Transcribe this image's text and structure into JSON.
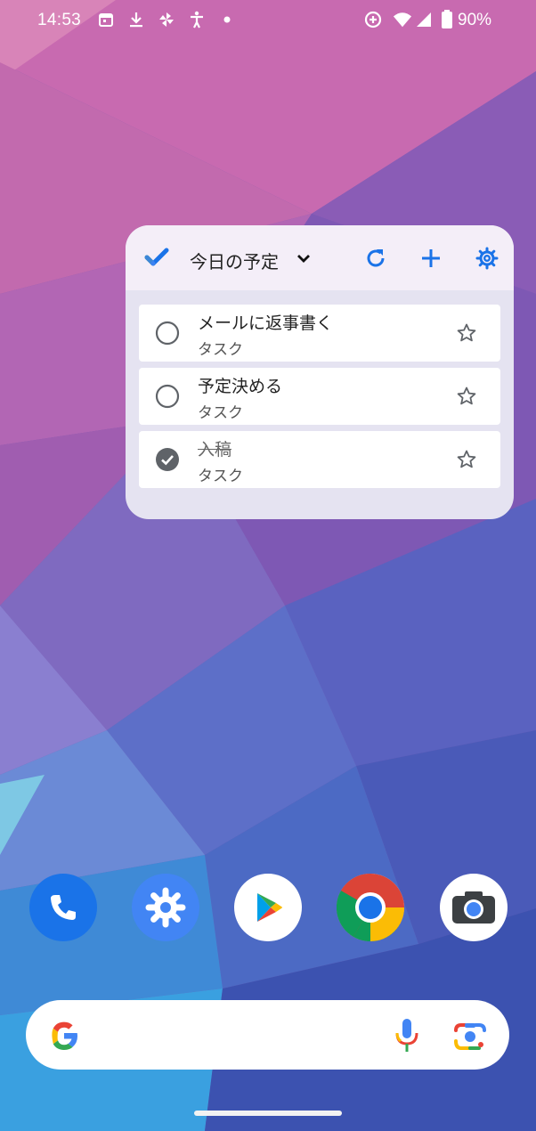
{
  "status_bar": {
    "time": "14:53",
    "battery": "90%",
    "left_icons": [
      "calendar-icon",
      "download-icon",
      "pinwheel-icon",
      "accessibility-icon",
      "dot-icon"
    ],
    "right_icons": [
      "data-saver-icon",
      "wifi-icon",
      "signal-icon",
      "battery-icon"
    ]
  },
  "widget": {
    "title": "今日の予定",
    "icons": {
      "logo": "tasks-check-icon",
      "dropdown": "chevron-down-icon",
      "refresh": "refresh-icon",
      "add": "plus-icon",
      "settings": "gear-icon"
    },
    "accent": "#1a73e8",
    "tasks": [
      {
        "title": "メールに返事書く",
        "list": "タスク",
        "completed": false,
        "starred": false
      },
      {
        "title": "予定決める",
        "list": "タスク",
        "completed": false,
        "starred": false
      },
      {
        "title": "入稿",
        "list": "タスク",
        "completed": true,
        "starred": false
      }
    ]
  },
  "dock": {
    "apps": [
      {
        "name": "phone",
        "icon": "phone-icon"
      },
      {
        "name": "settings",
        "icon": "settings-icon"
      },
      {
        "name": "play-store",
        "icon": "play-store-icon"
      },
      {
        "name": "chrome",
        "icon": "chrome-icon"
      },
      {
        "name": "camera",
        "icon": "camera-icon"
      }
    ]
  },
  "search_bar": {
    "icons": [
      "google-g-icon",
      "microphone-icon",
      "lens-icon"
    ]
  }
}
